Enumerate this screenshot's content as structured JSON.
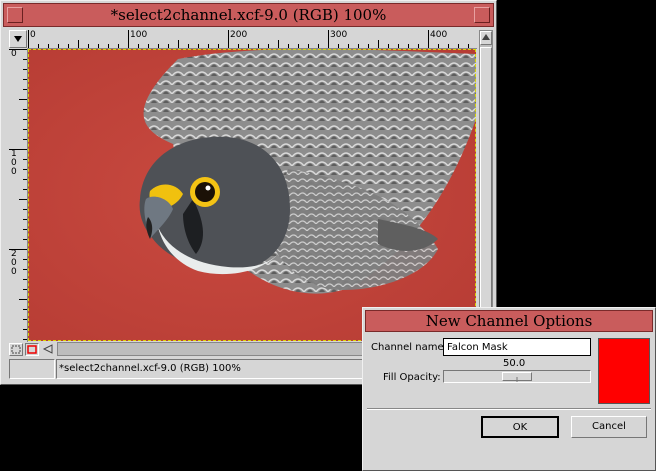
{
  "image_window": {
    "title": "*select2channel.xcf-9.0 (RGB) 100%",
    "ruler_top_labels": [
      "0",
      "100",
      "200",
      "300",
      "400"
    ],
    "ruler_left_labels": [
      "0",
      "1\n0\n0",
      "2\n0\n0"
    ],
    "status_text": "*select2channel.xcf-9.0 (RGB) 100%"
  },
  "dialog": {
    "title": "New Channel Options",
    "channel_name_label": "Channel name:",
    "channel_name_value": "Falcon Mask",
    "fill_opacity_label": "Fill Opacity:",
    "fill_opacity_value": "50.0",
    "fill_opacity": 50.0,
    "ok_label": "OK",
    "cancel_label": "Cancel"
  },
  "colors": {
    "titlebar": "#c95c5c",
    "mask_color": "#ff0000",
    "canvas_background": "#c2433b"
  }
}
